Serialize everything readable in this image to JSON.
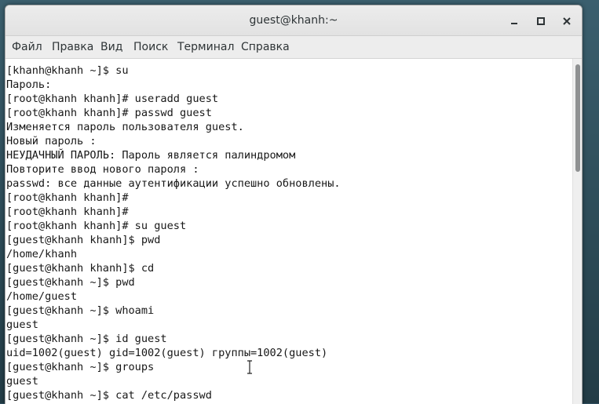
{
  "window": {
    "title": "guest@khanh:~",
    "buttons": {
      "minimize": "minimize-icon",
      "maximize": "maximize-icon",
      "close": "close-icon"
    }
  },
  "menu": {
    "items": [
      "Файл",
      "Правка",
      "Вид",
      "Поиск",
      "Терминал",
      "Справка"
    ]
  },
  "terminal": {
    "lines": [
      "[khanh@khanh ~]$ su",
      "Пароль:",
      "[root@khanh khanh]# useradd guest",
      "[root@khanh khanh]# passwd guest",
      "Изменяется пароль пользователя guest.",
      "Новый пароль :",
      "НЕУДАЧНЫЙ ПАРОЛЬ: Пароль является палиндромом",
      "Повторите ввод нового пароля :",
      "passwd: все данные аутентификации успешно обновлены.",
      "[root@khanh khanh]#",
      "[root@khanh khanh]#",
      "[root@khanh khanh]# su guest",
      "[guest@khanh khanh]$ pwd",
      "/home/khanh",
      "[guest@khanh khanh]$ cd",
      "[guest@khanh ~]$ pwd",
      "/home/guest",
      "[guest@khanh ~]$ whoami",
      "guest",
      "[guest@khanh ~]$ id guest",
      "uid=1002(guest) gid=1002(guest) группы=1002(guest)",
      "[guest@khanh ~]$ groups",
      "guest",
      "[guest@khanh ~]$ cat /etc/passwd"
    ],
    "scroll_position": 0
  },
  "colors": {
    "titlebar": "#e6e6e6",
    "menubar": "#ededed",
    "terminal_bg": "#ffffff",
    "terminal_fg": "#171717",
    "scroll_thumb": "#8f9192"
  }
}
